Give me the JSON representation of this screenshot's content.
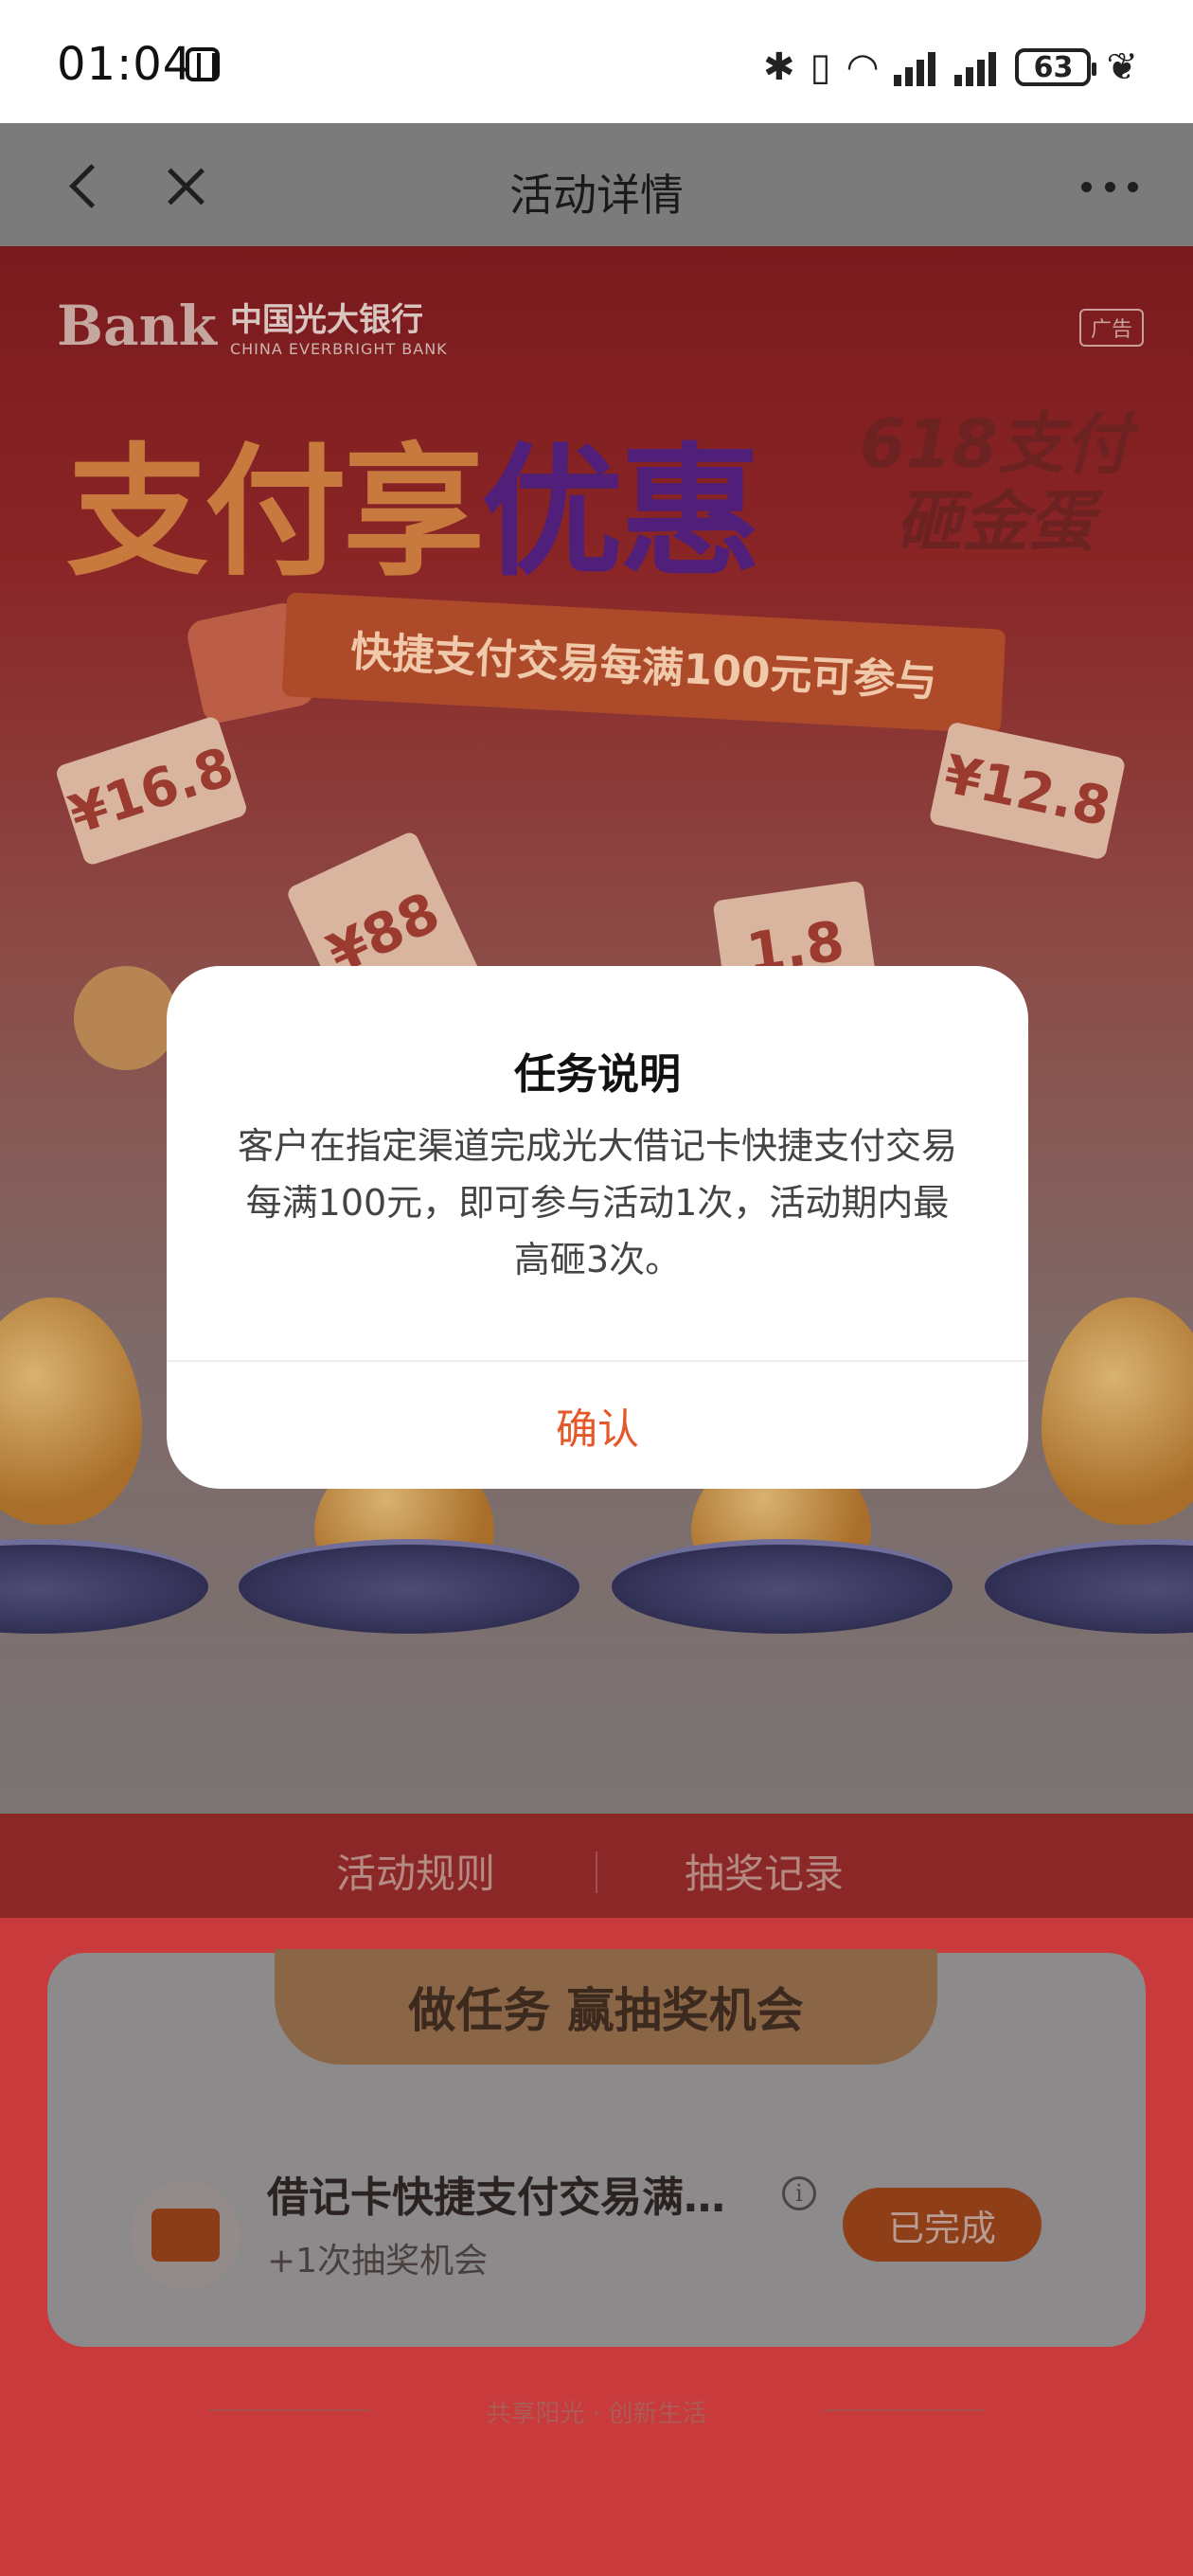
{
  "status_bar": {
    "time": "01:04",
    "battery": "63"
  },
  "header": {
    "title": "活动详情"
  },
  "banner": {
    "bank_name_cn": "中国光大银行",
    "bank_name_en": "CHINA EVERBRIGHT BANK",
    "bank_mark": "Bank",
    "ad_tag": "广告",
    "title_part1": "支付享",
    "title_part2": "优惠",
    "side_title_line1": "618支付",
    "side_title_line2": "砸金蛋",
    "ribbon_text": "快捷支付交易每满100元可参与",
    "coupons": [
      "¥16.8",
      "¥12.8",
      "¥88",
      "1.8"
    ]
  },
  "tabs": {
    "rules": "活动规则",
    "records": "抽奖记录"
  },
  "task_card": {
    "heading": "做任务 赢抽奖机会",
    "task_name": "借记卡快捷支付交易满…",
    "task_reward": "+1次抽奖机会",
    "status_button": "已完成"
  },
  "footer": {
    "slogan": "共享阳光 · 创新生活"
  },
  "modal": {
    "title": "任务说明",
    "body": "客户在指定渠道完成光大借记卡快捷支付交易每满100元，即可参与活动1次，活动期内最高砸3次。",
    "confirm": "确认"
  },
  "colors": {
    "accent": "#e5582a",
    "overlay_page_bg": "#c93a3c"
  }
}
